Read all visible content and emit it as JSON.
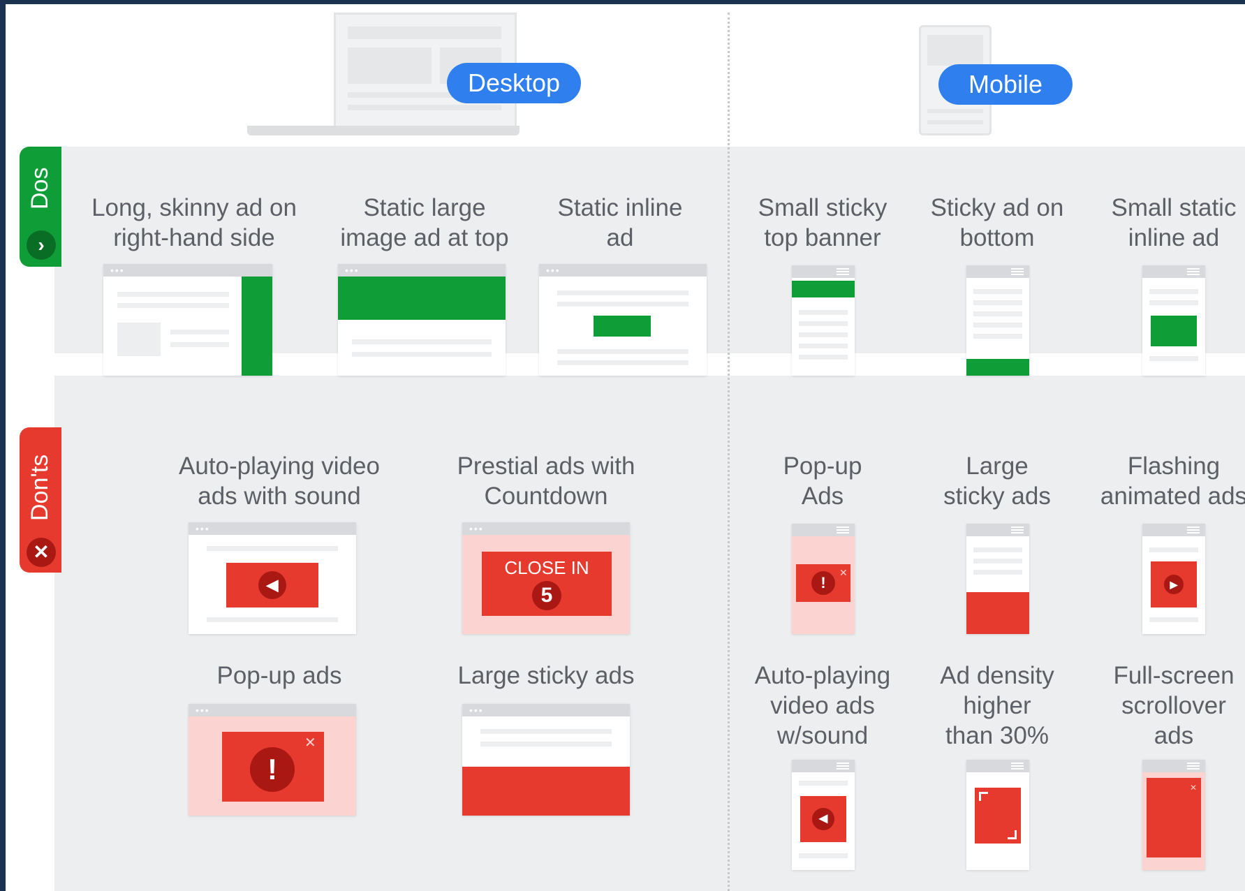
{
  "headers": {
    "desktop": "Desktop",
    "mobile": "Mobile"
  },
  "sections": {
    "dos": "Dos",
    "donts": "Don'ts"
  },
  "tab_icons": {
    "dos": "checkmark-icon",
    "donts": "close-icon"
  },
  "dos": {
    "desktop": [
      "Long, skinny ad on\nright-hand side",
      "Static large\nimage ad at top",
      "Static inline\nad"
    ],
    "mobile": [
      "Small sticky\ntop banner",
      "Sticky ad on\nbottom",
      "Small static\ninline ad"
    ]
  },
  "donts": {
    "desktop": [
      "Auto-playing video\nads with sound",
      "Prestial ads with\nCountdown",
      "Pop-up ads",
      "Large sticky ads"
    ],
    "mobile": [
      "Pop-up\nAds",
      "Large\nsticky ads",
      "Flashing\nanimated ads",
      "Auto-playing\nvideo ads\nw/sound",
      "Ad density\nhigher\nthan 30%",
      "Full-screen\nscrollover\nads"
    ]
  },
  "countdown": {
    "text": "CLOSE IN",
    "number": "5"
  },
  "colors": {
    "accent_blue": "#2f80ee",
    "do_green": "#0f9d37",
    "dont_red": "#e63a2e",
    "band_gray": "#eceef0"
  }
}
